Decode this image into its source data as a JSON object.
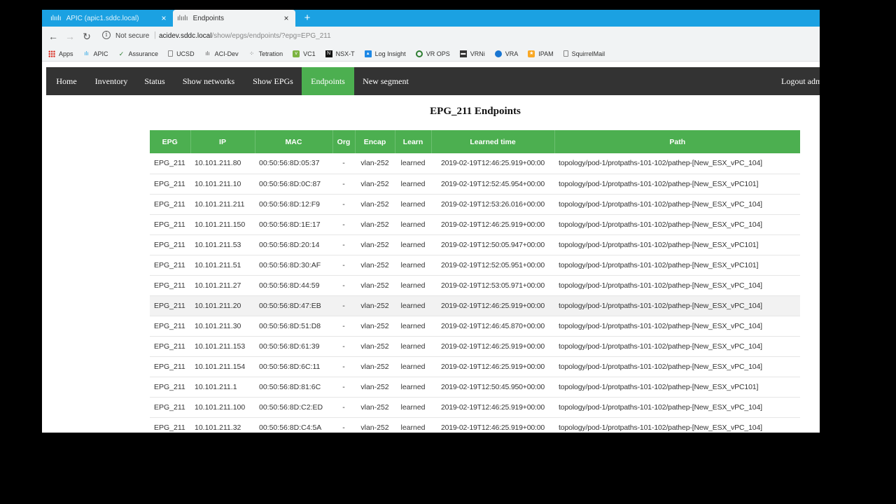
{
  "browser": {
    "tabs": [
      {
        "title": "APIC (apic1.sddc.local)",
        "active": false,
        "favicon": "cisco-icon"
      },
      {
        "title": "Endpoints",
        "active": true,
        "favicon": "cisco-icon"
      }
    ],
    "new_tab": "+",
    "close": "×",
    "security_label": "Not secure",
    "url_host": "acidev.sddc.local",
    "url_path": "/show/epgs/endpoints/?epg=EPG_211",
    "bookmarks": [
      {
        "label": "Apps",
        "icon": "apps-grid-icon"
      },
      {
        "label": "APIC",
        "icon": "cisco-icon"
      },
      {
        "label": "Assurance",
        "icon": "check-icon"
      },
      {
        "label": "UCSD",
        "icon": "page-icon"
      },
      {
        "label": "ACI-Dev",
        "icon": "cisco-icon"
      },
      {
        "label": "Tetration",
        "icon": "dots-icon"
      },
      {
        "label": "VC1",
        "icon": "vsphere-icon"
      },
      {
        "label": "NSX-T",
        "icon": "nsx-icon"
      },
      {
        "label": "Log Insight",
        "icon": "chart-icon"
      },
      {
        "label": "VR OPS",
        "icon": "vrops-icon"
      },
      {
        "label": "VRNi",
        "icon": "vrni-icon"
      },
      {
        "label": "VRA",
        "icon": "globe-icon"
      },
      {
        "label": "IPAM",
        "icon": "ipam-icon"
      },
      {
        "label": "SquirrelMail",
        "icon": "page-icon"
      }
    ]
  },
  "nav": {
    "home": "Home",
    "inventory": "Inventory",
    "status": "Status",
    "show_networks": "Show networks",
    "show_epgs": "Show EPGs",
    "endpoints": "Endpoints",
    "new_segment": "New segment",
    "logout": "Logout admin"
  },
  "page": {
    "title": "EPG_211 Endpoints"
  },
  "table": {
    "headers": [
      "EPG",
      "IP",
      "MAC",
      "Org",
      "Encap",
      "Learn",
      "Learned time",
      "Path"
    ],
    "rows": [
      [
        "EPG_211",
        "10.101.211.80",
        "00:50:56:8D:05:37",
        "-",
        "vlan-252",
        "learned",
        "2019-02-19T12:46:25.919+00:00",
        "topology/pod-1/protpaths-101-102/pathep-[New_ESX_vPC_104]"
      ],
      [
        "EPG_211",
        "10.101.211.10",
        "00:50:56:8D:0C:87",
        "-",
        "vlan-252",
        "learned",
        "2019-02-19T12:52:45.954+00:00",
        "topology/pod-1/protpaths-101-102/pathep-[New_ESX_vPC101]"
      ],
      [
        "EPG_211",
        "10.101.211.211",
        "00:50:56:8D:12:F9",
        "-",
        "vlan-252",
        "learned",
        "2019-02-19T12:53:26.016+00:00",
        "topology/pod-1/protpaths-101-102/pathep-[New_ESX_vPC_104]"
      ],
      [
        "EPG_211",
        "10.101.211.150",
        "00:50:56:8D:1E:17",
        "-",
        "vlan-252",
        "learned",
        "2019-02-19T12:46:25.919+00:00",
        "topology/pod-1/protpaths-101-102/pathep-[New_ESX_vPC_104]"
      ],
      [
        "EPG_211",
        "10.101.211.53",
        "00:50:56:8D:20:14",
        "-",
        "vlan-252",
        "learned",
        "2019-02-19T12:50:05.947+00:00",
        "topology/pod-1/protpaths-101-102/pathep-[New_ESX_vPC101]"
      ],
      [
        "EPG_211",
        "10.101.211.51",
        "00:50:56:8D:30:AF",
        "-",
        "vlan-252",
        "learned",
        "2019-02-19T12:52:05.951+00:00",
        "topology/pod-1/protpaths-101-102/pathep-[New_ESX_vPC101]"
      ],
      [
        "EPG_211",
        "10.101.211.27",
        "00:50:56:8D:44:59",
        "-",
        "vlan-252",
        "learned",
        "2019-02-19T12:53:05.971+00:00",
        "topology/pod-1/protpaths-101-102/pathep-[New_ESX_vPC_104]"
      ],
      [
        "EPG_211",
        "10.101.211.20",
        "00:50:56:8D:47:EB",
        "-",
        "vlan-252",
        "learned",
        "2019-02-19T12:46:25.919+00:00",
        "topology/pod-1/protpaths-101-102/pathep-[New_ESX_vPC_104]"
      ],
      [
        "EPG_211",
        "10.101.211.30",
        "00:50:56:8D:51:D8",
        "-",
        "vlan-252",
        "learned",
        "2019-02-19T12:46:45.870+00:00",
        "topology/pod-1/protpaths-101-102/pathep-[New_ESX_vPC_104]"
      ],
      [
        "EPG_211",
        "10.101.211.153",
        "00:50:56:8D:61:39",
        "-",
        "vlan-252",
        "learned",
        "2019-02-19T12:46:25.919+00:00",
        "topology/pod-1/protpaths-101-102/pathep-[New_ESX_vPC_104]"
      ],
      [
        "EPG_211",
        "10.101.211.154",
        "00:50:56:8D:6C:11",
        "-",
        "vlan-252",
        "learned",
        "2019-02-19T12:46:25.919+00:00",
        "topology/pod-1/protpaths-101-102/pathep-[New_ESX_vPC_104]"
      ],
      [
        "EPG_211",
        "10.101.211.1",
        "00:50:56:8D:81:6C",
        "-",
        "vlan-252",
        "learned",
        "2019-02-19T12:50:45.950+00:00",
        "topology/pod-1/protpaths-101-102/pathep-[New_ESX_vPC101]"
      ],
      [
        "EPG_211",
        "10.101.211.100",
        "00:50:56:8D:C2:ED",
        "-",
        "vlan-252",
        "learned",
        "2019-02-19T12:46:25.919+00:00",
        "topology/pod-1/protpaths-101-102/pathep-[New_ESX_vPC_104]"
      ],
      [
        "EPG_211",
        "10.101.211.32",
        "00:50:56:8D:C4:5A",
        "-",
        "vlan-252",
        "learned",
        "2019-02-19T12:46:25.919+00:00",
        "topology/pod-1/protpaths-101-102/pathep-[New_ESX_vPC_104]"
      ]
    ],
    "highlighted_row": 7
  },
  "colors": {
    "accent": "#4caf50",
    "navbar": "#333333",
    "tabstrip": "#1ba1e2"
  }
}
